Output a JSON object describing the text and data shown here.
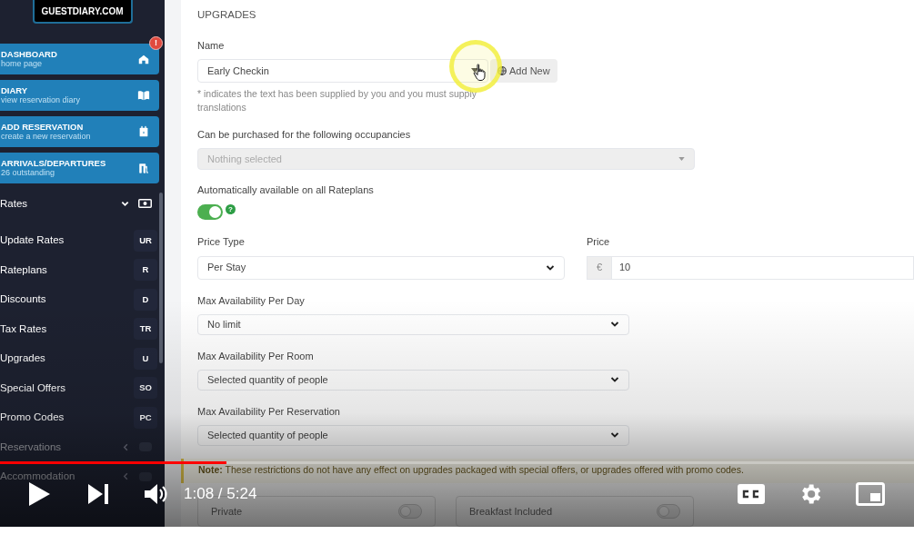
{
  "sidebar": {
    "logo": "GUESTDIARY.COM",
    "nav_cards": [
      {
        "title": "DASHBOARD",
        "subtitle": "home page",
        "badge": "!"
      },
      {
        "title": "DIARY",
        "subtitle": "view reservation diary"
      },
      {
        "title": "ADD RESERVATION",
        "subtitle": "create a new reservation"
      },
      {
        "title": "ARRIVALS/DEPARTURES",
        "subtitle": "26 outstanding"
      }
    ],
    "menu": [
      {
        "kind": "group",
        "label": "Rates",
        "expanded": true
      },
      {
        "kind": "item",
        "label": "Update Rates",
        "shortcut": "UR"
      },
      {
        "kind": "item",
        "label": "Rateplans",
        "shortcut": "R"
      },
      {
        "kind": "item",
        "label": "Discounts",
        "shortcut": "D"
      },
      {
        "kind": "item",
        "label": "Tax Rates",
        "shortcut": "TR"
      },
      {
        "kind": "item",
        "label": "Upgrades",
        "shortcut": "U"
      },
      {
        "kind": "item",
        "label": "Special Offers",
        "shortcut": "SO"
      },
      {
        "kind": "item",
        "label": "Promo Codes",
        "shortcut": "PC"
      },
      {
        "kind": "group",
        "label": "Reservations",
        "expanded": false
      },
      {
        "kind": "group",
        "label": "Accommodation",
        "expanded": false
      }
    ]
  },
  "form": {
    "section_title": "UPGRADES",
    "name": {
      "label": "Name",
      "value": "Early Checkin",
      "button": "Add New",
      "hint": "* indicates the text has been supplied by you and you must supply translations"
    },
    "occupancies": {
      "label": "Can be purchased for the following occupancies",
      "placeholder": "Nothing selected",
      "disabled": true
    },
    "auto_available": {
      "label": "Automatically available on all Rateplans",
      "on": true,
      "help": "?"
    },
    "price_type": {
      "label": "Price Type",
      "value": "Per Stay"
    },
    "price": {
      "label": "Price",
      "prefix": "€",
      "value": "10"
    },
    "availability": [
      {
        "label": "Max Availability Per Day",
        "value": "No limit"
      },
      {
        "label": "Max Availability Per Room",
        "value": "Selected quantity of people"
      },
      {
        "label": "Max Availability Per Reservation",
        "value": "Selected quantity of people"
      }
    ],
    "note": "**Note:** These restrictions do not have any effect on upgrades packaged with special offers, or upgrades offered with promo codes.",
    "options": [
      {
        "label": "Private",
        "on": false
      },
      {
        "label": "Breakfast Included",
        "on": false
      }
    ]
  },
  "player": {
    "time": "1:08 / 5:24",
    "progress": {
      "level": 0.248
    }
  }
}
